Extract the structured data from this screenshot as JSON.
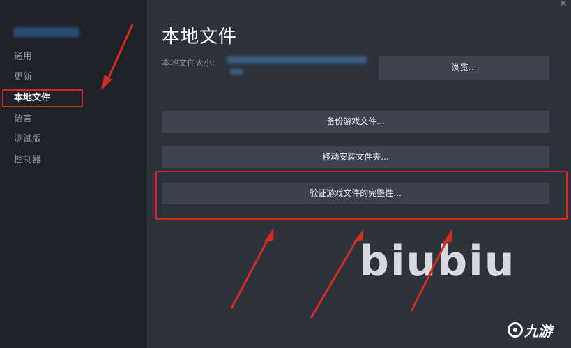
{
  "sidebar": {
    "items": [
      {
        "label": "通用",
        "active": false
      },
      {
        "label": "更新",
        "active": false
      },
      {
        "label": "本地文件",
        "active": true
      },
      {
        "label": "语言",
        "active": false
      },
      {
        "label": "测试版",
        "active": false
      },
      {
        "label": "控制器",
        "active": false
      }
    ]
  },
  "main": {
    "title": "本地文件",
    "size_label": "本地文件大小:",
    "browse_label": "浏览...",
    "backup_label": "备份游戏文件...",
    "move_label": "移动安装文件夹...",
    "verify_label": "验证游戏文件的完整性..."
  },
  "watermark": {
    "big_text": "biubiu",
    "logo_text": "九游"
  },
  "colors": {
    "highlight": "#d2271f",
    "sidebar_bg": "#1e2228",
    "main_bg": "#2d333c",
    "button_bg": "#3d4450"
  },
  "icons": {
    "close": "close-icon"
  }
}
